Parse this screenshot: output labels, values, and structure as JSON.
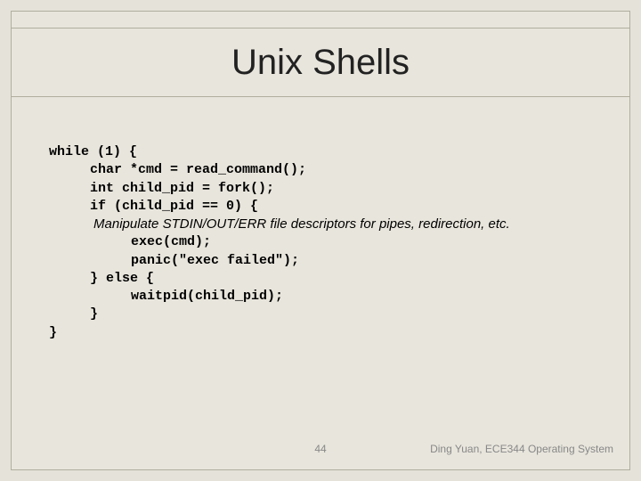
{
  "slide": {
    "title": "Unix Shells",
    "page_number": "44",
    "credit": "Ding Yuan, ECE344 Operating System"
  },
  "code": {
    "l0": "while (1) {",
    "l1": "char *cmd = read_command();",
    "l2": "int child_pid = fork();",
    "l3": "if (child_pid == 0) {",
    "c0": "            Manipulate STDIN/OUT/ERR file descriptors for pipes, redirection, etc.",
    "l4": "exec(cmd);",
    "l5": "panic(\"exec failed\");",
    "l6": "} else {",
    "l7": "waitpid(child_pid);",
    "l8": "}",
    "l9": "}"
  }
}
